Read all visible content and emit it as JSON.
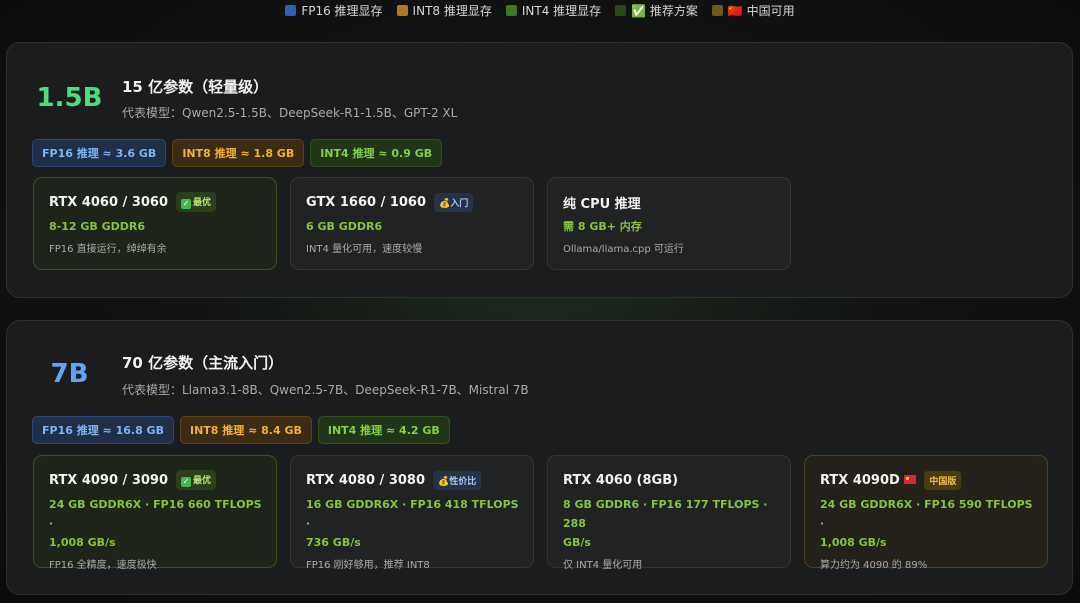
{
  "legend": [
    {
      "label": "FP16 推理显存",
      "color": "#2f5fb0"
    },
    {
      "label": "INT8 推理显存",
      "color": "#b07a1f"
    },
    {
      "label": "INT4 推理显存",
      "color": "#3d7a1f"
    },
    {
      "label": "✅ 推荐方案",
      "color": "#264a1b"
    },
    {
      "label": "🇨🇳 中国可用",
      "color": "#6b5a1a"
    }
  ],
  "tiers": [
    {
      "size": "1.5B",
      "title": "15 亿参数（轻量级）",
      "models": "代表模型：Qwen2.5-1.5B、DeepSeek-R1-1.5B、GPT-2 XL",
      "badges": {
        "fp16": "FP16 推理 ≈ 3.6 GB",
        "int8": "INT8 推理 ≈ 1.8 GB",
        "int4": "INT4 推理 ≈ 0.9 GB"
      },
      "gpus": [
        {
          "name": "RTX 4060 / 3060",
          "tag": "最优",
          "spec": "8-12 GB GDDR6",
          "note": "FP16 直接运行，绰绰有余"
        },
        {
          "name": "GTX 1660 / 1060",
          "tag": "入门",
          "spec": "6 GB GDDR6",
          "note": "INT4 量化可用，速度较慢"
        },
        {
          "name": "纯 CPU 推理",
          "spec": "需 8 GB+ 内存",
          "note": "Ollama/llama.cpp 可运行"
        }
      ]
    },
    {
      "size": "7B",
      "title": "70 亿参数（主流入门）",
      "models": "代表模型：Llama3.1-8B、Qwen2.5-7B、DeepSeek-R1-7B、Mistral 7B",
      "badges": {
        "fp16": "FP16 推理 ≈ 16.8 GB",
        "int8": "INT8 推理 ≈ 8.4 GB",
        "int4": "INT4 推理 ≈ 4.2 GB"
      },
      "gpus": [
        {
          "name": "RTX 4090 / 3090",
          "tag": "最优",
          "spec_line1": "24 GB GDDR6X · FP16 660 TFLOPS ·",
          "spec_line2": "1,008 GB/s",
          "note": "FP16 全精度，速度极快"
        },
        {
          "name": "RTX 4080 / 3080",
          "tag": "性价比",
          "spec_line1": "16 GB GDDR6X · FP16 418 TFLOPS ·",
          "spec_line2": "736 GB/s",
          "note": "FP16 刚好够用，推荐 INT8"
        },
        {
          "name": "RTX 4060 (8GB)",
          "spec_line1": "8 GB GDDR6 · FP16 177 TFLOPS · 288",
          "spec_line2": "GB/s",
          "note": "仅 INT4 量化可用"
        },
        {
          "name": "RTX 4090D",
          "tag": "中国版",
          "spec_line1": "24 GB GDDR6X · FP16 590 TFLOPS ·",
          "spec_line2": "1,008 GB/s",
          "note": "算力约为 4090 的 89%"
        }
      ]
    }
  ]
}
